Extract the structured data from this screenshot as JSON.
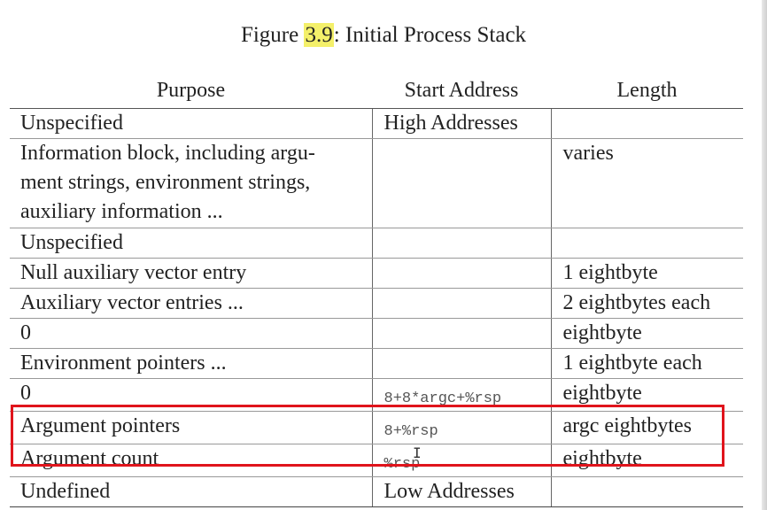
{
  "figure": {
    "label_prefix": "Figure ",
    "number": "3.9",
    "label_suffix": ": Initial Process Stack",
    "highlight_color": "#f4f06a"
  },
  "table": {
    "headers": [
      "Purpose",
      "Start Address",
      "Length"
    ],
    "rows": [
      {
        "purpose": "Unspecified",
        "address": "High Addresses",
        "length": ""
      },
      {
        "purpose": "Information block, including argu-\nment strings, environment strings,\nauxiliary information ...",
        "address": "",
        "length": "varies"
      },
      {
        "purpose": "Unspecified",
        "address": "",
        "length": ""
      },
      {
        "purpose": "Null auxiliary vector entry",
        "address": "",
        "length": "1 eightbyte"
      },
      {
        "purpose": "Auxiliary vector entries ...",
        "address": "",
        "length": "2 eightbytes each"
      },
      {
        "purpose": "0",
        "address": "",
        "length": "eightbyte"
      },
      {
        "purpose": "Environment pointers ...",
        "address": "",
        "length": "1 eightbyte each"
      },
      {
        "purpose": "0",
        "address": "8+8*argc+%rsp",
        "length": "eightbyte"
      },
      {
        "purpose": "Argument pointers",
        "address": "8+%rsp",
        "length": "argc eightbytes"
      },
      {
        "purpose": "Argument count",
        "address": "%rsp",
        "length": "eightbyte"
      },
      {
        "purpose": "Undefined",
        "address": "Low Addresses",
        "length": ""
      }
    ]
  },
  "annotation": {
    "box_color": "#e0141c",
    "cursor_glyph": "I"
  }
}
